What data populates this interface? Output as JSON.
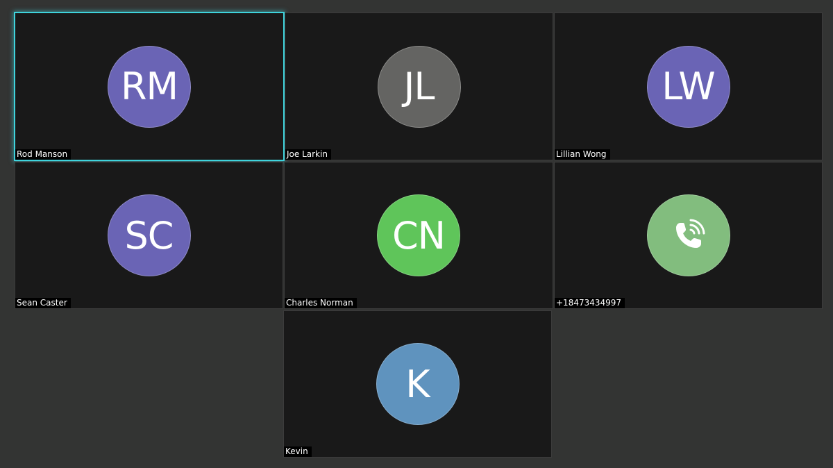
{
  "active_color": "#3fd3dc",
  "participants": [
    {
      "name": "Rod Manson",
      "initials": "RM",
      "avatar_color": "#6a64b5",
      "active": true
    },
    {
      "name": "Joe Larkin",
      "initials": "JL",
      "avatar_color": "#646462",
      "active": false
    },
    {
      "name": "Lillian Wong",
      "initials": "LW",
      "avatar_color": "#6a64b5",
      "active": false
    },
    {
      "name": "Sean Caster",
      "initials": "SC",
      "avatar_color": "#6a64b5",
      "active": false
    },
    {
      "name": "Charles Norman",
      "initials": "CN",
      "avatar_color": "#5fc55a",
      "active": false
    },
    {
      "name": "+18473434997",
      "icon": "phone-call-icon",
      "avatar_color": "#82bd7e",
      "active": false
    },
    {
      "name": "Kevin",
      "initials": "K",
      "avatar_color": "#5f93be",
      "active": false
    }
  ]
}
